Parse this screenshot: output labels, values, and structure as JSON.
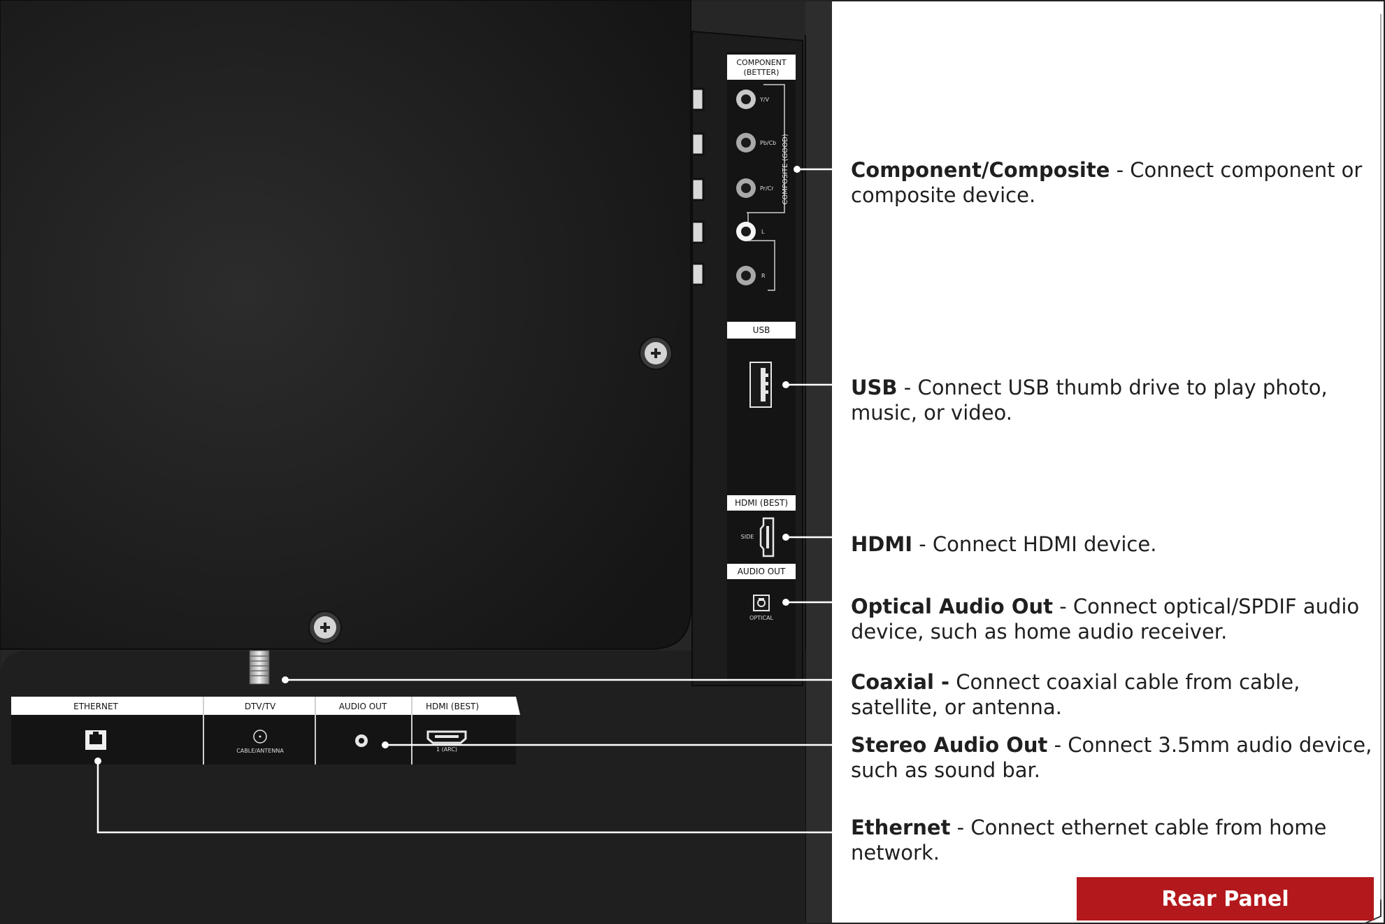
{
  "panel": {
    "title": "Rear Panel",
    "labels": {
      "component": "COMPONENT",
      "component_sub": "(BETTER)",
      "composite": "COMPOSITE (GOOD)",
      "y_v": "Y/V",
      "pb_cb": "Pb/Cb",
      "pr_cr": "Pr/Cr",
      "l": "L",
      "r": "R",
      "usb": "USB",
      "hdmi_side": "HDMI (BEST)",
      "side": "SIDE",
      "audio_out_side": "AUDIO OUT",
      "optical": "OPTICAL",
      "ethernet": "ETHERNET",
      "dtv_tv": "DTV/TV",
      "cable_antenna": "CABLE/ANTENNA",
      "audio_out_bottom": "AUDIO OUT",
      "hdmi_bottom": "HDMI (BEST)",
      "hdmi_arc": "1 (ARC)"
    }
  },
  "callouts": [
    {
      "name": "Component/Composite",
      "sep": " - ",
      "text": "Connect component or composite device."
    },
    {
      "name": "USB",
      "sep": " - ",
      "text": "Connect USB thumb drive to play photo, music, or video."
    },
    {
      "name": "HDMI",
      "sep": " - ",
      "text": "Connect HDMI device."
    },
    {
      "name": "Optical Audio Out",
      "sep": " - ",
      "text": "Connect optical/SPDIF audio device, such as home audio receiver."
    },
    {
      "name": "Coaxial -",
      "sep": " ",
      "text": "Connect coaxial cable from cable, satellite, or antenna."
    },
    {
      "name": "Stereo Audio Out",
      "sep": " - ",
      "text": "Connect 3.5mm audio device, such as sound bar."
    },
    {
      "name": "Ethernet",
      "sep": " - ",
      "text": "Connect ethernet cable from home network."
    }
  ],
  "colors": {
    "tv_back": "#262626",
    "panel_inner": "#1b1b1b",
    "port_strip": "#141414",
    "label_bg": "#ffffff",
    "accent": "#b3181c"
  }
}
